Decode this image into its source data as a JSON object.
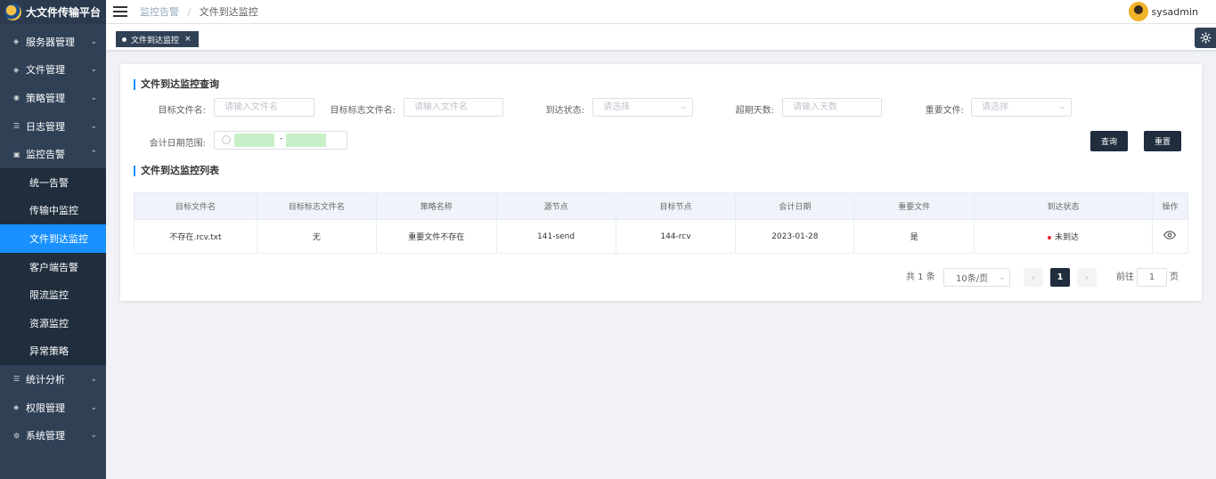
{
  "app": {
    "title": "大文件传输平台"
  },
  "sidebar": {
    "items": [
      {
        "label": "服务器管理",
        "icon": "server-icon",
        "arrow": "⌄"
      },
      {
        "label": "文件管理",
        "icon": "file-icon",
        "arrow": "⌄"
      },
      {
        "label": "策略管理",
        "icon": "policy-icon",
        "arrow": "⌄"
      },
      {
        "label": "日志管理",
        "icon": "log-icon",
        "arrow": "⌄"
      },
      {
        "label": "监控告警",
        "icon": "monitor-icon",
        "arrow": "⌃"
      }
    ],
    "subitems": [
      "统一告警",
      "传输中监控",
      "文件到达监控",
      "客户端告警",
      "限流监控",
      "资源监控",
      "异常策略"
    ],
    "bottom_items": [
      {
        "label": "统计分析",
        "icon": "stats-icon",
        "arrow": "⌄"
      },
      {
        "label": "权限管理",
        "icon": "permission-icon",
        "arrow": "⌄"
      },
      {
        "label": "系统管理",
        "icon": "system-icon",
        "arrow": "⌄"
      }
    ]
  },
  "header": {
    "breadcrumb_parent": "监控告警",
    "breadcrumb_sep": "/",
    "breadcrumb_current": "文件到达监控",
    "username": "sysadmin"
  },
  "tags": {
    "active": "文件到达监控",
    "close": "×"
  },
  "query": {
    "title": "文件到达监控查询",
    "target_file_label": "目标文件名:",
    "target_file_placeholder": "请输入文件名",
    "flag_file_label": "目标标志文件名:",
    "flag_file_placeholder": "请输入文件名",
    "arrival_status_label": "到达状态:",
    "arrival_status_placeholder": "请选择",
    "overdue_days_label": "超期天数:",
    "overdue_days_placeholder": "请输入天数",
    "important_file_label": "重要文件:",
    "important_file_placeholder": "请选择",
    "date_range_label": "会计日期范围:",
    "date_sep": "-",
    "search_button": "查询",
    "reset_button": "重置"
  },
  "list": {
    "title": "文件到达监控列表",
    "columns": [
      "目标文件名",
      "目标标志文件名",
      "策略名称",
      "源节点",
      "目标节点",
      "会计日期",
      "重要文件",
      "到达状态",
      "操作"
    ],
    "rows": [
      {
        "target_file": "不存在.rcv.txt",
        "flag_file": "无",
        "policy": "重要文件不存在",
        "source": "141-send",
        "target": "144-rcv",
        "date": "2023-01-28",
        "important": "是",
        "status": "未到达"
      }
    ]
  },
  "pagination": {
    "total": "共 1 条",
    "page_size": "10条/页",
    "current_page": "1",
    "goto_label": "前往",
    "goto_value": "1",
    "page_unit": "页"
  },
  "colors": {
    "sidebar_bg": "#304156",
    "active": "#1890ff",
    "button": "#1f2d3d",
    "status_dot": "#f5222d"
  }
}
